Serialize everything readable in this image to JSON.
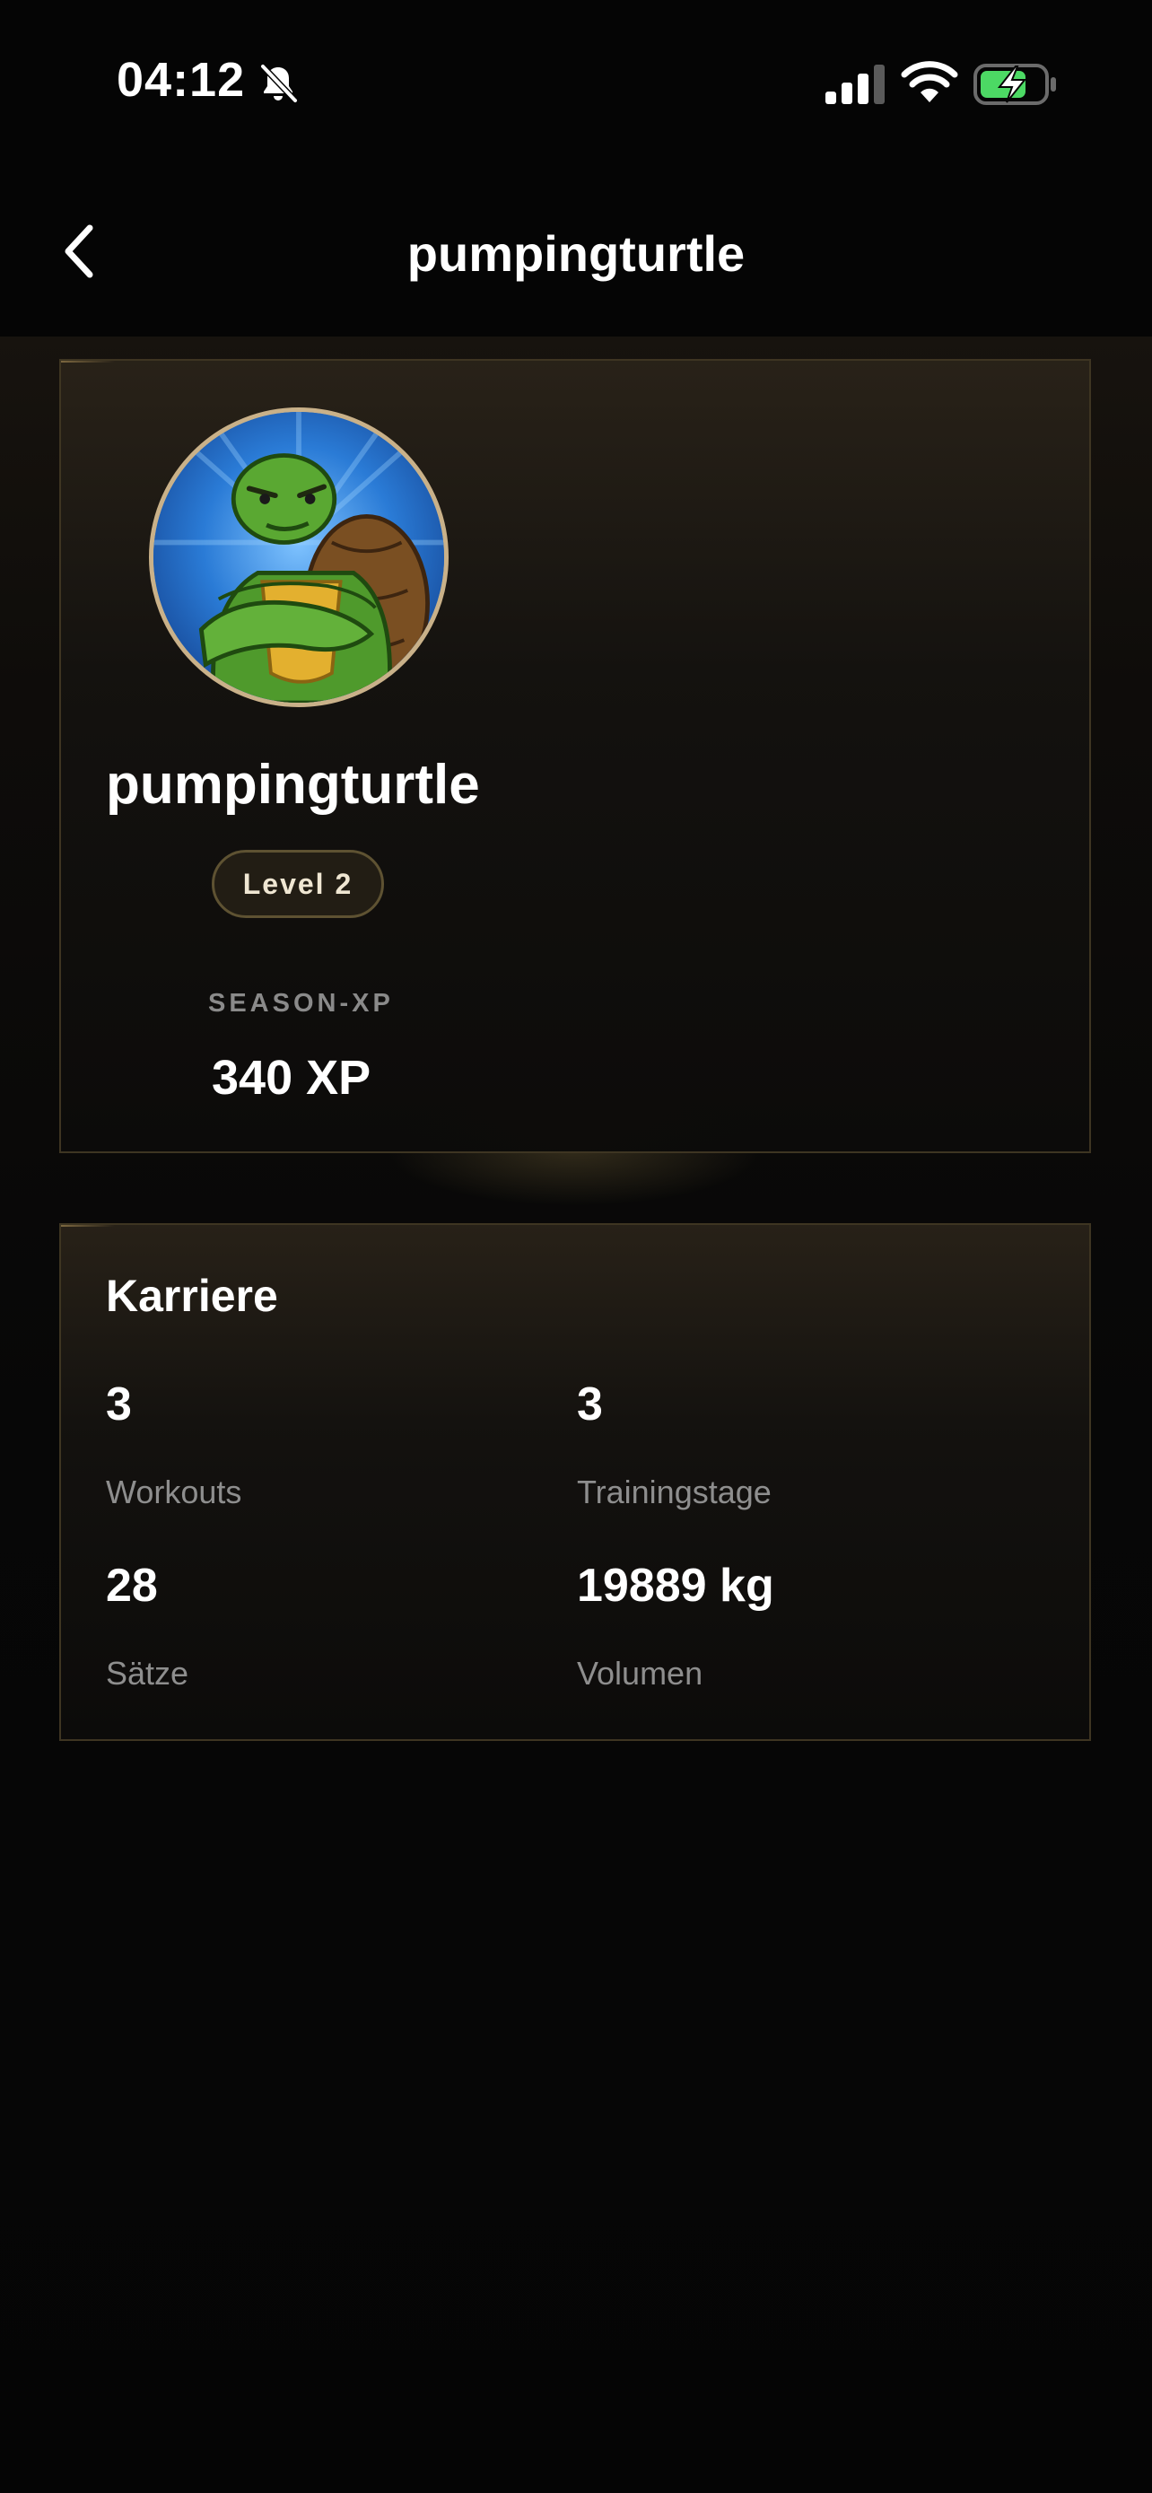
{
  "status_bar": {
    "time": "04:12",
    "icons": [
      "bell-slash-icon",
      "cellular-signal-icon",
      "wifi-icon",
      "battery-charging-icon"
    ]
  },
  "nav": {
    "back_icon": "chevron-left-icon",
    "title": "pumpingturtle"
  },
  "profile": {
    "avatar": "turtle-avatar",
    "name": "pumpingturtle",
    "level": "Level 2",
    "xp_label": "SEASON-XP",
    "xp_value": "340 XP"
  },
  "career": {
    "title": "Karriere",
    "stats": [
      {
        "value": "3",
        "label": "Workouts"
      },
      {
        "value": "3",
        "label": "Trainingstage"
      },
      {
        "value": "28",
        "label": "Sätze"
      },
      {
        "value": "19889 kg",
        "label": "Volumen"
      }
    ]
  },
  "colors": {
    "background": "#050505",
    "card_border": "#3e3522",
    "accent_gold": "#c9b189",
    "battery_green": "#4cd964",
    "muted_text": "#8e8e8e"
  }
}
